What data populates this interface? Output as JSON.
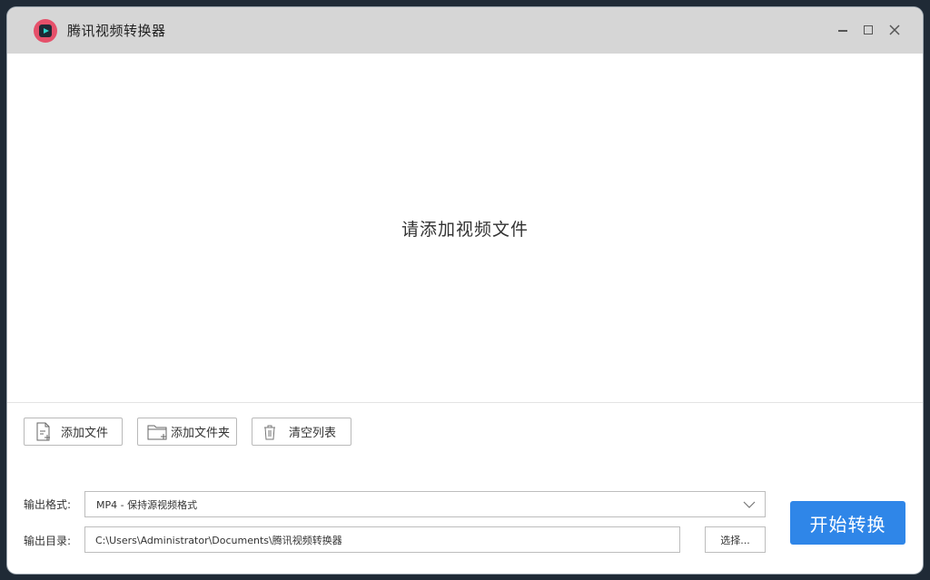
{
  "window": {
    "title": "腾讯视频转换器",
    "controls": {
      "minimize": "minimize-icon",
      "maximize": "maximize-icon",
      "close": "close-icon"
    }
  },
  "dropzone": {
    "text": "请添加视频文件"
  },
  "toolbar": {
    "add_file_label": "添加文件",
    "add_folder_label": "添加文件夹",
    "clear_list_label": "清空列表"
  },
  "output": {
    "format_label": "输出格式:",
    "format_value": "MP4 - 保持源视频格式",
    "dir_label": "输出目录:",
    "dir_value": "C:\\Users\\Administrator\\Documents\\腾讯视频转换器",
    "browse_label": "选择..."
  },
  "actions": {
    "start_label": "开始转换"
  },
  "colors": {
    "titlebar": "#d6d6d6",
    "primary": "#2f86e8",
    "logo": "#e5506a"
  }
}
